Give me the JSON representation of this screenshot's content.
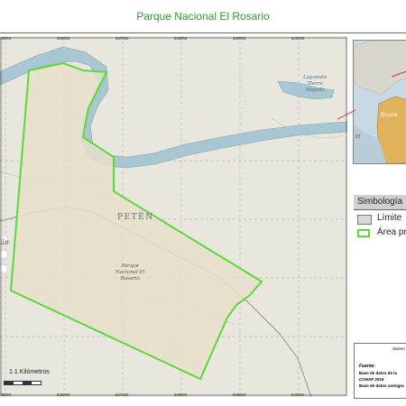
{
  "title": "Parque Nacional El Rosario",
  "colors": {
    "park_outline": "#5bd93a",
    "park_fill": "#e6dfcb",
    "water": "#a9c7d2",
    "terrain": "#e9e6dd",
    "title": "#2f9a2f"
  },
  "map": {
    "region_label": "PETÉN",
    "park_label_line1": "Parque",
    "park_label_line2": "Nacional El",
    "park_label_line3": "Rosario",
    "lagoon_label_line1": "Laguneta",
    "lagoon_label_line2": "Tierra",
    "lagoon_label_line3": "Mojada",
    "town_label_fragment": "lle",
    "x_ticks": [
      "535000",
      "536000",
      "537000",
      "538000",
      "539000",
      "540000"
    ],
    "y_ticks": [
      "1828000",
      "1827000",
      "1826000",
      "1825000",
      "1824000"
    ],
    "scale_label": "1.1 Kilómetros"
  },
  "inset": {
    "place_label": "Guate",
    "number_label": "27"
  },
  "legend": {
    "title": "Simbología",
    "items": [
      {
        "label": "Límite",
        "color": "#d9d9d9"
      },
      {
        "label": "Área pr",
        "color": "#5bd93a"
      }
    ]
  },
  "source_box": {
    "title": "Sistem",
    "fuente": "Fuente:",
    "line1": "Base de datos de la",
    "line2": "CONAP 2016",
    "line3": "Base de datos cartogra"
  },
  "icons": [
    "park-boundary-outline",
    "river",
    "lagoon",
    "road",
    "inset-map"
  ]
}
